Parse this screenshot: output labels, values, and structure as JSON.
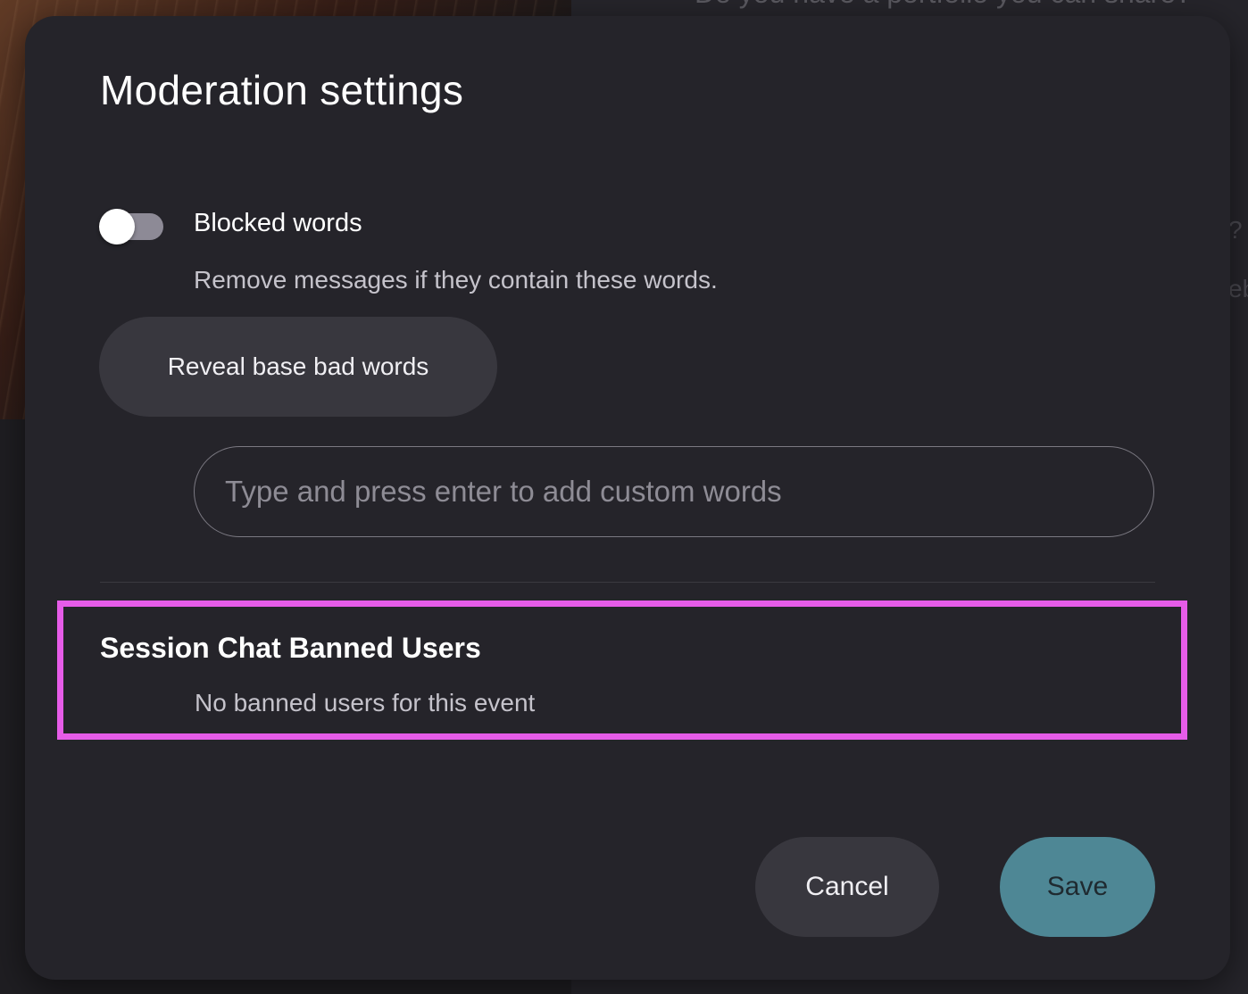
{
  "background": {
    "headline_fragment": "Do you have a portfolio you can share?",
    "side_fragment_1": "?",
    "side_fragment_2": "eb"
  },
  "modal": {
    "title": "Moderation settings",
    "blocked_words": {
      "label": "Blocked words",
      "enabled": false,
      "description": "Remove messages if they contain these words.",
      "reveal_button_label": "Reveal base bad words",
      "input_placeholder": "Type and press enter to add custom words",
      "input_value": ""
    },
    "banned_users": {
      "heading": "Session Chat Banned Users",
      "empty_message": "No banned users for this event"
    },
    "actions": {
      "cancel_label": "Cancel",
      "save_label": "Save"
    }
  },
  "colors": {
    "modal_background": "#25242a",
    "accent_save": "#4e8795",
    "highlight_border": "#e65ce8",
    "toggle_track_off": "#8d8a96"
  }
}
